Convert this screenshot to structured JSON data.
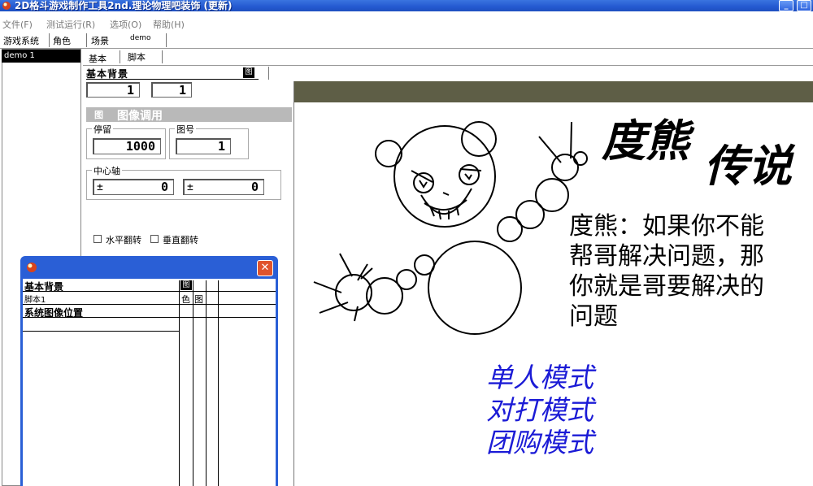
{
  "window": {
    "title": "2D格斗游戏制作工具2nd.理论物理吧装饰 (更新)",
    "minimize_label": "_",
    "restore_label": "□"
  },
  "menu": [
    "文件(F)",
    "测试运行(R)",
    "选项(O)",
    "帮助(H)"
  ],
  "tabs_top": {
    "game_system": "游戏系统",
    "character": "角色",
    "scene": "场景",
    "demo": "demo"
  },
  "tabs_sub": {
    "basic": "基本",
    "script": "脚本"
  },
  "list": {
    "items": [
      "demo 1"
    ]
  },
  "props": {
    "section_basic": "基本背景",
    "section_basic_icon": "图",
    "field_a": "1",
    "field_b": "1",
    "section_image": "图像调用",
    "section_image_icon": "图",
    "stay_label": "停留",
    "stay_value": "1000",
    "imgno_label": "图号",
    "imgno_value": "1",
    "axis_label": "中心轴",
    "axis_x_sign": "±",
    "axis_x_value": "0",
    "axis_y_sign": "±",
    "axis_y_value": "0",
    "flip_h": "水平翻转",
    "flip_v": "垂直翻转"
  },
  "float_window": {
    "close_label": "✕",
    "rows": [
      {
        "label": "基本背景",
        "c1": "图",
        "c2": "",
        "bold": true
      },
      {
        "label": "脚本1",
        "c1": "色",
        "c2": "图",
        "bold": false
      },
      {
        "label": "系统图像位置",
        "c1": "",
        "c2": "",
        "bold": true
      }
    ]
  },
  "canvas": {
    "title_part1": "度熊",
    "title_part2": "传说",
    "dialog_lines": [
      "度熊：如果你不能",
      "帮哥解决问题，那",
      "你就是哥要解决的",
      "问题"
    ],
    "modes": [
      "单人模式",
      "对打模式",
      "团购模式"
    ],
    "mode_color": "#1b1bd6",
    "bar_color": "#5e5e46"
  }
}
